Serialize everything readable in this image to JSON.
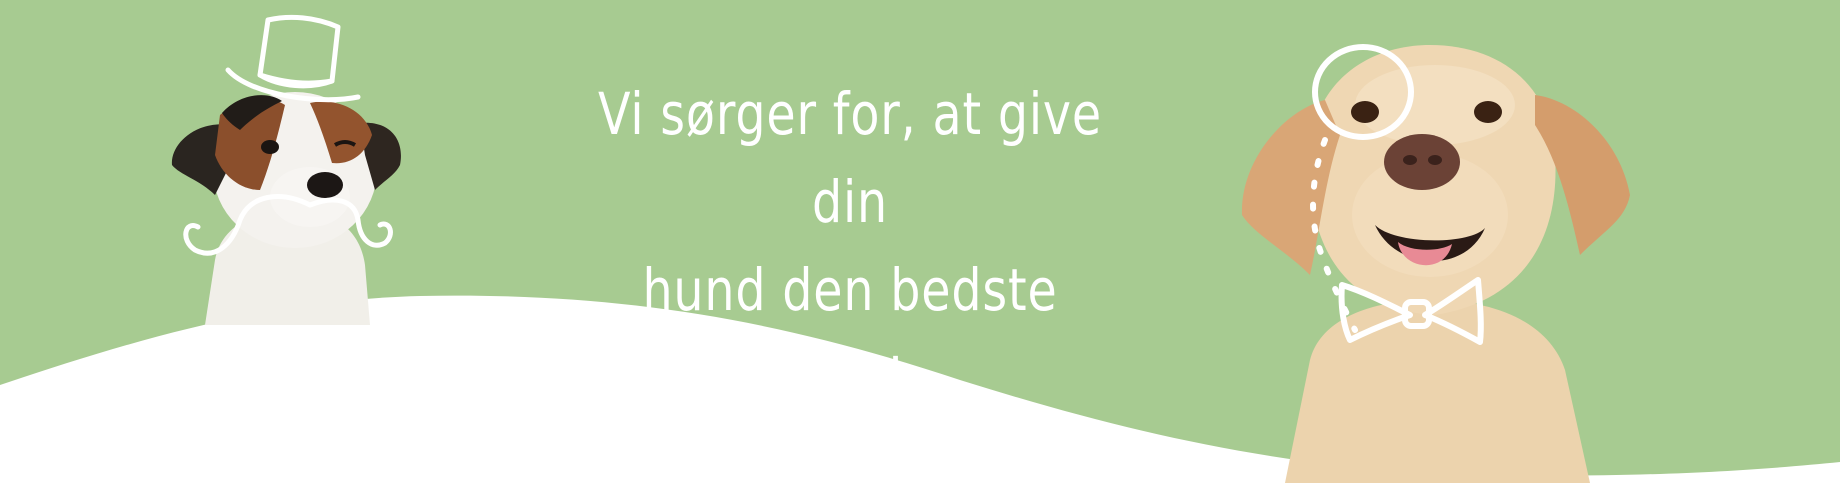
{
  "banner": {
    "headline_line1": "Vi sørger for, at give din",
    "headline_line2": "hund den bedste dag!",
    "background_color": "#a7cb91",
    "wave_color": "#ffffff",
    "text_color": "#ffffff"
  },
  "illustrations": {
    "left": [
      "terrier-dog",
      "top-hat-icon",
      "mustache-icon"
    ],
    "right": [
      "labrador-dog",
      "monocle-icon",
      "bow-tie-icon"
    ]
  }
}
